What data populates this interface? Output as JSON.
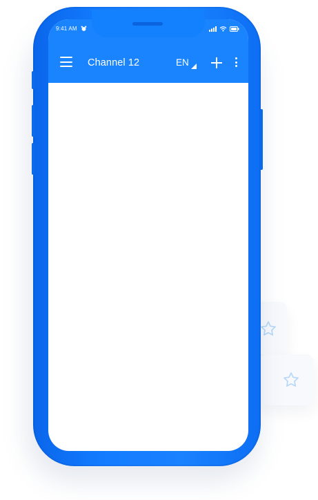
{
  "status_bar": {
    "time": "9:41 AM"
  },
  "app_bar": {
    "title": "Channel 12",
    "language": "EN",
    "icons": {
      "menu": "hamburger-menu-icon",
      "language_dropdown": "corner-triangle-icon",
      "add": "plus-icon",
      "more": "vertical-ellipsis-icon"
    }
  },
  "decorations": {
    "cards": [
      {
        "icon": "star-outline-icon"
      },
      {
        "icon": "star-outline-icon"
      }
    ]
  },
  "colors": {
    "phone_blue": "#137bff",
    "app_bar_blue": "#1a84ff",
    "screen_background": "#ffffff",
    "star_outline": "#b8d8f7"
  }
}
